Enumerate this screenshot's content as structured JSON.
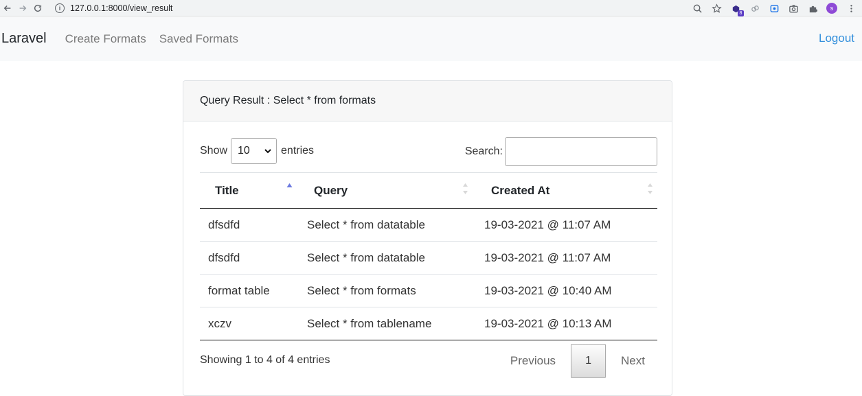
{
  "browser": {
    "url": "127.0.0.1:8000/view_result",
    "extension_badge": "8",
    "profile_initial": "s",
    "icons": [
      "back-arrow-icon",
      "forward-arrow-icon",
      "reload-icon",
      "info-icon",
      "zoom-icon",
      "star-icon",
      "extension-icon",
      "puzzle-icon",
      "menu-dots-icon"
    ]
  },
  "navbar": {
    "brand": "Laravel",
    "links": [
      "Create Formats",
      "Saved Formats"
    ],
    "logout": "Logout",
    "link_color": "#3490dc"
  },
  "card": {
    "header": "Query Result : Select * from formats"
  },
  "datatable": {
    "length_label_before": "Show",
    "length_value": "10",
    "length_label_after": "entries",
    "search_label": "Search:",
    "search_value": "",
    "columns": [
      "Title",
      "Query",
      "Created At"
    ],
    "rows": [
      [
        "dfsdfd",
        "Select * from datatable",
        "19-03-2021 @ 11:07 AM"
      ],
      [
        "dfsdfd",
        "Select * from datatable",
        "19-03-2021 @ 11:07 AM"
      ],
      [
        "format table",
        "Select * from formats",
        "19-03-2021 @ 10:40 AM"
      ],
      [
        "xczv",
        "Select * from tablename",
        "19-03-2021 @ 10:13 AM"
      ]
    ],
    "info": "Showing 1 to 4 of 4 entries",
    "pagination": {
      "previous": "Previous",
      "current": "1",
      "next": "Next"
    }
  }
}
